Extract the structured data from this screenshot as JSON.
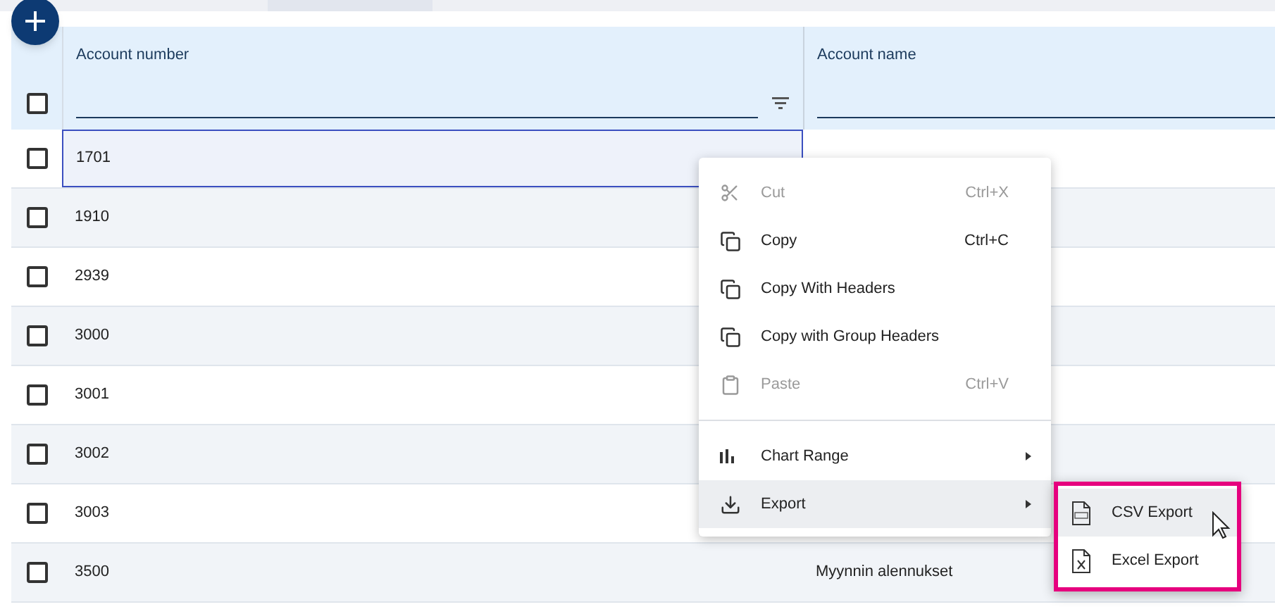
{
  "columns": [
    {
      "label": "Account number",
      "filter_icon": true
    },
    {
      "label": "Account name",
      "filter_icon": false
    }
  ],
  "header_checkbox": {
    "checked": false
  },
  "rows": [
    {
      "checked": false,
      "account_number": "1701",
      "account_name": "",
      "focused": true
    },
    {
      "checked": false,
      "account_number": "1910",
      "account_name": "",
      "focused": false
    },
    {
      "checked": false,
      "account_number": "2939",
      "account_name": "",
      "focused": false
    },
    {
      "checked": false,
      "account_number": "3000",
      "account_name": "",
      "focused": false
    },
    {
      "checked": false,
      "account_number": "3001",
      "account_name": "",
      "focused": false
    },
    {
      "checked": false,
      "account_number": "3002",
      "account_name": "",
      "focused": false
    },
    {
      "checked": false,
      "account_number": "3003",
      "account_name": "",
      "focused": false
    },
    {
      "checked": false,
      "account_number": "3500",
      "account_name": "Myynnin alennukset",
      "focused": false
    }
  ],
  "context_menu": [
    {
      "kind": "item",
      "label": "Cut",
      "shortcut": "Ctrl+X",
      "disabled": true,
      "submenu": false,
      "selected": false
    },
    {
      "kind": "item",
      "label": "Copy",
      "shortcut": "Ctrl+C",
      "disabled": false,
      "submenu": false,
      "selected": false
    },
    {
      "kind": "item",
      "label": "Copy With Headers",
      "disabled": false,
      "submenu": false,
      "selected": false
    },
    {
      "kind": "item",
      "label": "Copy with Group Headers",
      "disabled": false,
      "submenu": false,
      "selected": false
    },
    {
      "kind": "item",
      "label": "Paste",
      "shortcut": "Ctrl+V",
      "disabled": true,
      "submenu": false,
      "selected": false
    },
    {
      "kind": "separator"
    },
    {
      "kind": "item",
      "label": "Chart Range",
      "disabled": false,
      "submenu": true,
      "selected": false
    },
    {
      "kind": "item",
      "label": "Export",
      "disabled": false,
      "submenu": true,
      "selected": true
    }
  ],
  "submenu": [
    {
      "label": "CSV Export",
      "selected": true
    },
    {
      "label": "Excel Export",
      "selected": false
    }
  ]
}
